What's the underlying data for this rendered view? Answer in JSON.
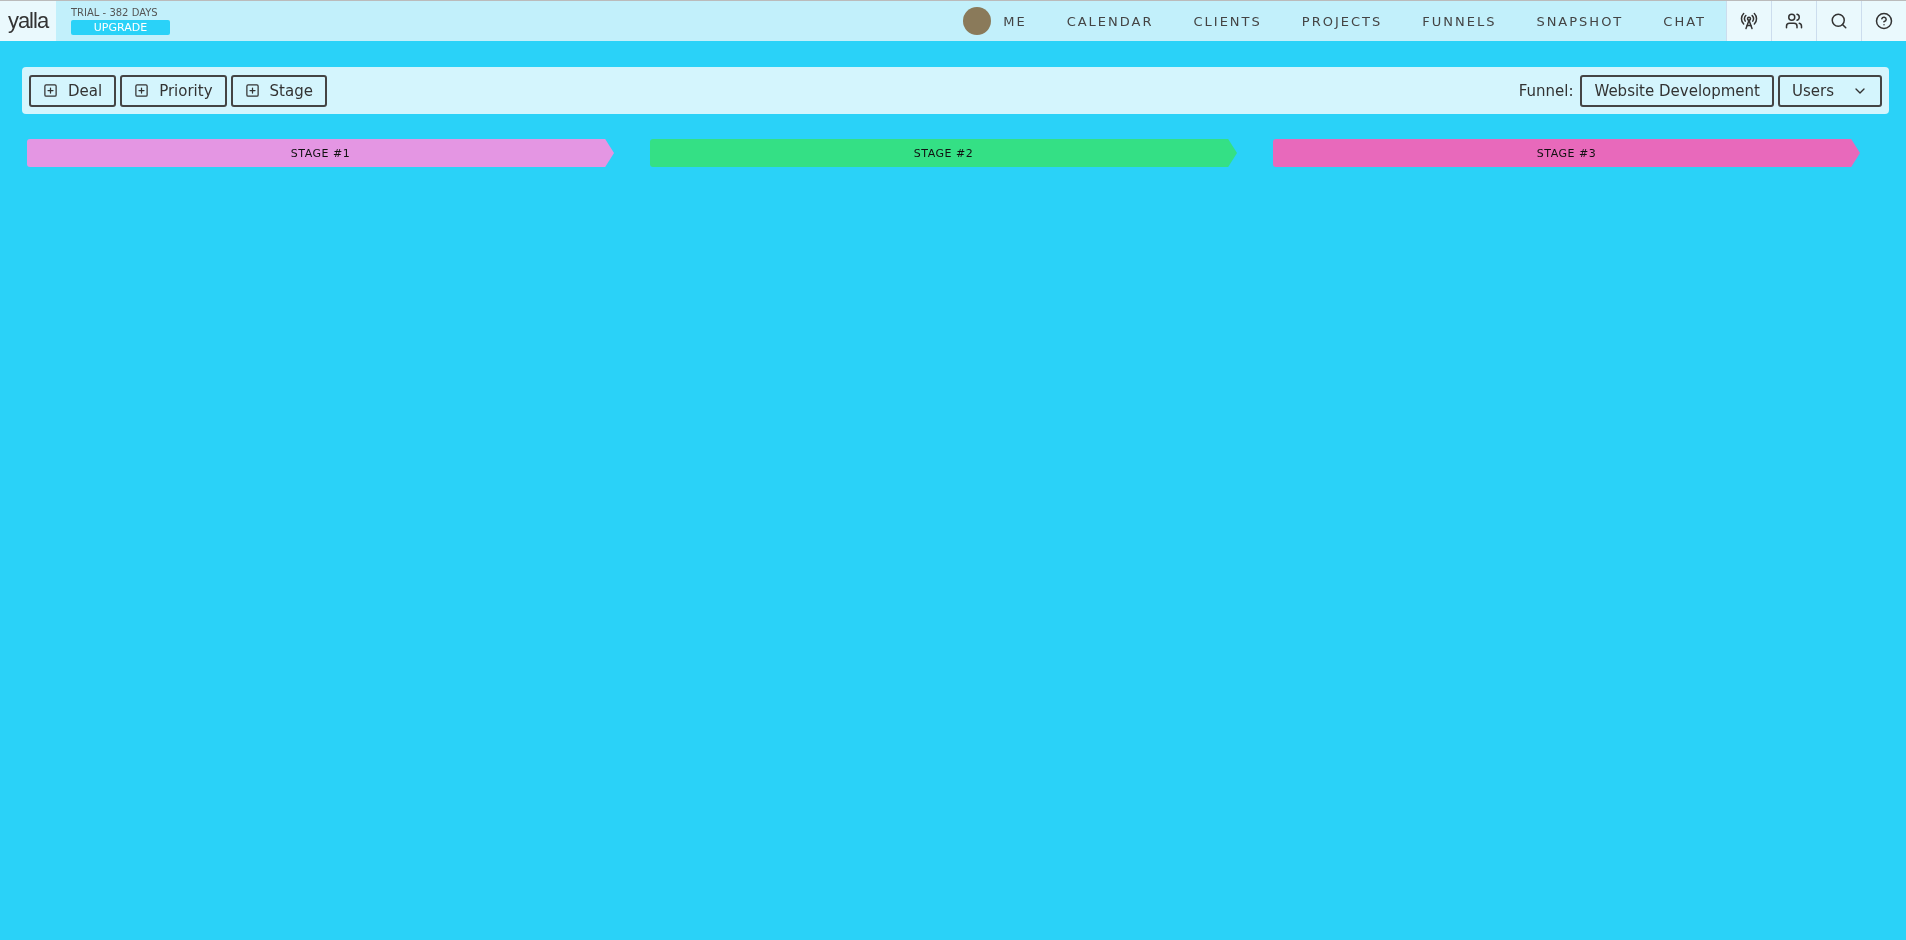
{
  "header": {
    "logo": "yalla",
    "trial": "TRIAL - 382 DAYS",
    "upgrade": "UPGRADE",
    "nav": [
      {
        "label": "ME",
        "kind": "avatar"
      },
      {
        "label": "CALENDAR",
        "kind": "link"
      },
      {
        "label": "CLIENTS",
        "kind": "link"
      },
      {
        "label": "PROJECTS",
        "kind": "link"
      },
      {
        "label": "FUNNELS",
        "kind": "link"
      },
      {
        "label": "SNAPSHOT",
        "kind": "link"
      },
      {
        "label": "CHAT",
        "kind": "link"
      }
    ],
    "icons": [
      {
        "kind": "broadcast"
      },
      {
        "kind": "team"
      },
      {
        "kind": "search"
      },
      {
        "kind": "help"
      }
    ]
  },
  "toolbar": {
    "add_buttons": [
      "Deal",
      "Priority",
      "Stage"
    ],
    "funnel_label": "Funnel:",
    "funnel": "Website Development",
    "users": "Users"
  },
  "stages": [
    {
      "name": "STAGE #1",
      "color": "#e496e3"
    },
    {
      "name": "STAGE #2",
      "color": "#34e085"
    },
    {
      "name": "STAGE #3",
      "color": "#e869bb"
    }
  ]
}
